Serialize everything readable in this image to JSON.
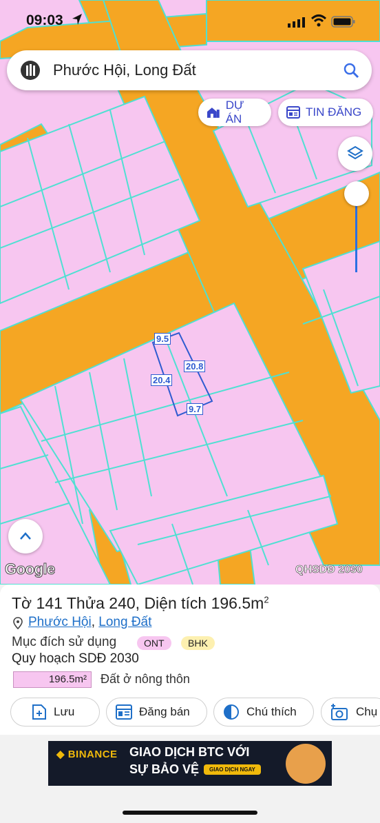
{
  "status": {
    "time": "09:03"
  },
  "search": {
    "query": "Phước Hội, Long Đất"
  },
  "chips": {
    "du_an": "DỰ ÁN",
    "tin_dang": "TIN ĐĂNG"
  },
  "map": {
    "watermark": "Google",
    "layer_label": "QHSDĐ 2030",
    "dimensions": {
      "top": "9.5",
      "right": "20.8",
      "left": "20.4",
      "bottom": "9.7"
    },
    "colors": {
      "residential": "#f7c6f0",
      "road": "#f5a623",
      "parcel_line": "#4fe0d2",
      "selection": "#2e5bd0"
    }
  },
  "parcel": {
    "title": "Tờ 141 Thửa 240, Diện tích 196.5m",
    "title_sup": "2",
    "ward": "Phước Hội",
    "district": "Long Đất",
    "purpose_label": "Mục đích sử dụng",
    "purpose_codes": [
      "ONT",
      "BHK"
    ],
    "plan_title": "Quy hoạch SDĐ 2030",
    "plan_area": "196.5m²",
    "plan_desc": "Đất ở nông thôn"
  },
  "actions": {
    "save": "Lưu",
    "sell": "Đăng bán",
    "legend": "Chú thích",
    "capture": "Chụ"
  },
  "ad": {
    "brand": "BINANCE",
    "line1": "GIAO DỊCH BTC VỚI",
    "line2": "SỰ BẢO VỆ",
    "cta": "GIAO DỊCH NGAY"
  }
}
